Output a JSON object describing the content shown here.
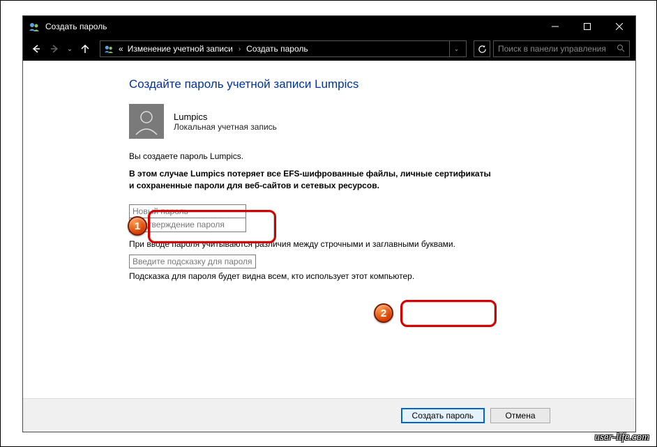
{
  "window": {
    "title": "Создать пароль"
  },
  "nav": {
    "breadcrumb_level1": "Изменение учетной записи",
    "breadcrumb_level2": "Создать пароль",
    "search_placeholder": "Поиск в панели управления"
  },
  "page": {
    "heading": "Создайте пароль учетной записи Lumpics",
    "user_name": "Lumpics",
    "user_type": "Локальная учетная запись",
    "desc1": "Вы создаете пароль Lumpics.",
    "desc2": "В этом случае Lumpics потеряет все EFS-шифрованные файлы, личные сертификаты и сохраненные пароли для веб-сайтов и сетевых ресурсов.",
    "new_password_placeholder": "Новый пароль",
    "confirm_password_placeholder": "Подтверждение пароля",
    "case_note": "При вводе пароля учитываются различия между строчными и заглавными буквами.",
    "hint_placeholder": "Введите подсказку для пароля",
    "hint_note": "Подсказка для пароля будет видна всем, кто использует этот компьютер."
  },
  "buttons": {
    "create": "Создать пароль",
    "cancel": "Отмена"
  },
  "annotations": {
    "badge1": "1",
    "badge2": "2"
  },
  "watermark": "user-life.com"
}
